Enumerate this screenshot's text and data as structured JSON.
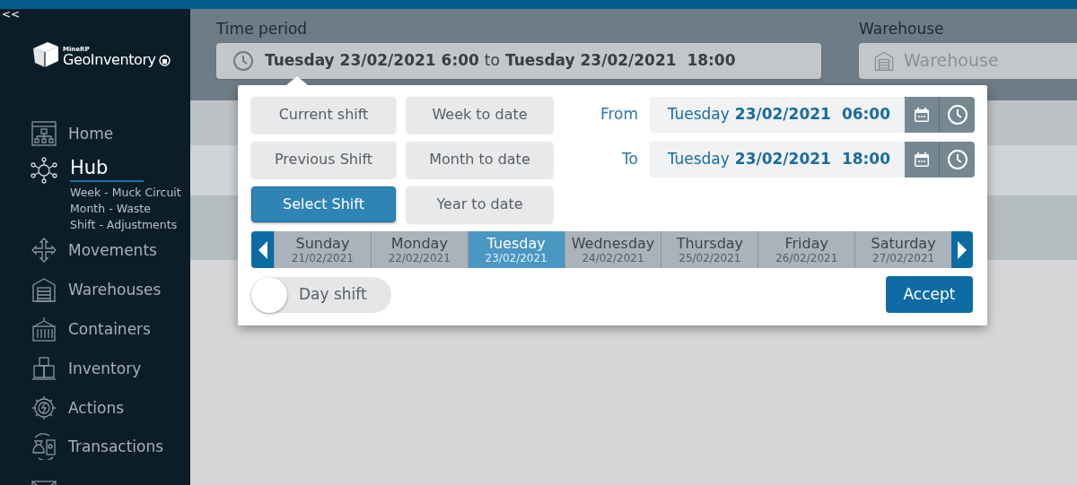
{
  "sidebar": {
    "collapse": "<<",
    "logo": {
      "brand": "MineRP",
      "product": "GeoInventory"
    },
    "items": [
      {
        "label": "Home",
        "selected": false
      },
      {
        "label": "Hub",
        "selected": true,
        "children": [
          {
            "label": "Week - Muck Circuit"
          },
          {
            "label": "Month - Waste"
          },
          {
            "label": "Shift - Adjustments"
          }
        ]
      },
      {
        "label": "Movements",
        "selected": false
      },
      {
        "label": "Warehouses",
        "selected": false
      },
      {
        "label": "Containers",
        "selected": false
      },
      {
        "label": "Inventory",
        "selected": false
      },
      {
        "label": "Actions",
        "selected": false
      },
      {
        "label": "Transactions",
        "selected": false
      }
    ]
  },
  "header": {
    "time_period": {
      "label": "Time period",
      "start": "Tuesday 23/02/2021 6:00",
      "joiner": "to",
      "end": "Tuesday 23/02/2021  18:00"
    },
    "warehouse": {
      "label": "Warehouse",
      "placeholder": "Warehouse"
    }
  },
  "popover": {
    "presets": [
      {
        "label": "Current shift",
        "selected": false
      },
      {
        "label": "Week to date",
        "selected": false
      },
      {
        "label": "Previous Shift",
        "selected": false
      },
      {
        "label": "Month to date",
        "selected": false
      },
      {
        "label": "Select Shift",
        "selected": true
      },
      {
        "label": "Year to date",
        "selected": false
      }
    ],
    "range": [
      {
        "label": "From",
        "day": "Tuesday",
        "date": "23/02/2021",
        "time": "06:00"
      },
      {
        "label": "To",
        "day": "Tuesday",
        "date": "23/02/2021",
        "time": "18:00"
      }
    ],
    "days": [
      {
        "name": "Sunday",
        "date": "21/02/2021",
        "selected": false
      },
      {
        "name": "Monday",
        "date": "22/02/2021",
        "selected": false
      },
      {
        "name": "Tuesday",
        "date": "23/02/2021",
        "selected": true
      },
      {
        "name": "Wednesday",
        "date": "24/02/2021",
        "selected": false
      },
      {
        "name": "Thursday",
        "date": "25/02/2021",
        "selected": false
      },
      {
        "name": "Friday",
        "date": "26/02/2021",
        "selected": false
      },
      {
        "name": "Saturday",
        "date": "27/02/2021",
        "selected": false
      }
    ],
    "toggle": {
      "label": "Day shift",
      "on": false
    },
    "accept": "Accept"
  }
}
